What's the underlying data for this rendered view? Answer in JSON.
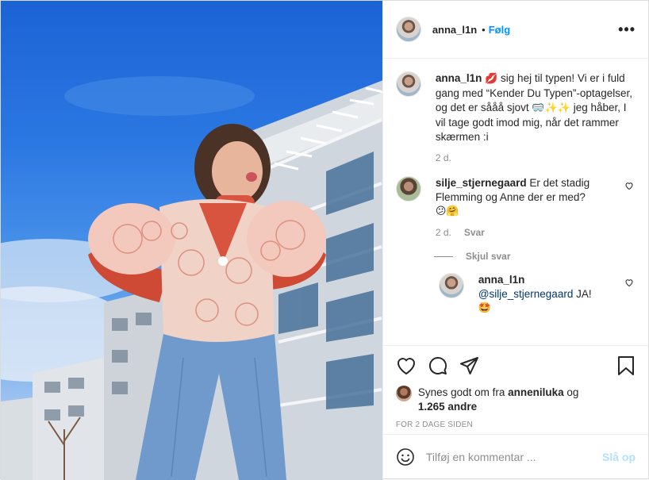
{
  "post": {
    "username": "anna_l1n",
    "separator": "•",
    "follow_label": "Følg",
    "more_label": "•••"
  },
  "caption": {
    "username": "anna_l1n",
    "emoji_start": "💋",
    "text": " sig hej til typen! Vi er i fuld gang med “Kender Du Typen”-optagelser, og det er sååå sjovt ",
    "emoji_mid": "🥽✨✨",
    "text_end": " jeg håber, I vil tage godt imod mig, når det rammer skærmen :i",
    "age": "2 d."
  },
  "comments": [
    {
      "username": "silje_stjernegaard",
      "text": " Er det stadig Flemming og Anne der er med?",
      "emoji": "😕🤗",
      "age": "2 d.",
      "reply_label": "Svar",
      "hide_replies_label": "Skjul svar"
    }
  ],
  "replies": [
    {
      "username": "anna_l1n",
      "mention": "@silje_stjernegaard",
      "text": " JA!",
      "emoji": "🤩"
    }
  ],
  "likes": {
    "prefix": "Synes godt om fra ",
    "liker": "anneniluka",
    "middle": " og",
    "others": "1.265 andre"
  },
  "timestamp": "FOR 2 DAGE SIDEN",
  "add_comment": {
    "placeholder": "Tilføj en kommentar ...",
    "post_label": "Slå op"
  },
  "colors": {
    "accent": "#0095f6",
    "post_disabled": "#b2dffc",
    "muted": "#8e8e8e"
  }
}
